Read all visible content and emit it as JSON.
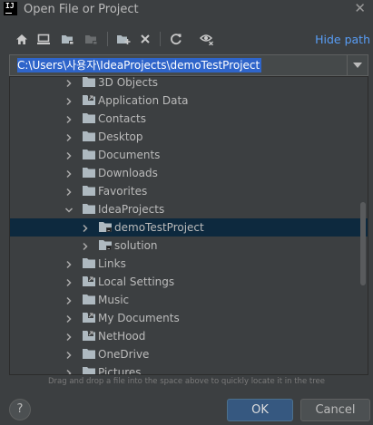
{
  "window": {
    "title": "Open File or Project",
    "app_icon_text": "IJ"
  },
  "toolbar": {
    "hide_path_label": "Hide path"
  },
  "path": {
    "value": "C:\\Users\\사용자\\IdeaProjects\\demoTestProject"
  },
  "tree": {
    "items": [
      {
        "label": "3D Objects",
        "arrow": "collapsed",
        "icon": "folder-icon",
        "level": 1
      },
      {
        "label": "Application Data",
        "arrow": "collapsed",
        "icon": "link-folder-icon",
        "level": 1
      },
      {
        "label": "Contacts",
        "arrow": "collapsed",
        "icon": "folder-icon",
        "level": 1
      },
      {
        "label": "Desktop",
        "arrow": "collapsed",
        "icon": "folder-icon",
        "level": 1
      },
      {
        "label": "Documents",
        "arrow": "collapsed",
        "icon": "folder-icon",
        "level": 1
      },
      {
        "label": "Downloads",
        "arrow": "collapsed",
        "icon": "folder-icon",
        "level": 1
      },
      {
        "label": "Favorites",
        "arrow": "collapsed",
        "icon": "folder-icon",
        "level": 1
      },
      {
        "label": "IdeaProjects",
        "arrow": "expanded",
        "icon": "folder-icon",
        "level": 1
      },
      {
        "label": "demoTestProject",
        "arrow": "collapsed",
        "icon": "project-folder-icon",
        "level": 2,
        "selected": true
      },
      {
        "label": "solution",
        "arrow": "collapsed",
        "icon": "project-folder-icon",
        "level": 2
      },
      {
        "label": "Links",
        "arrow": "collapsed",
        "icon": "folder-icon",
        "level": 1
      },
      {
        "label": "Local Settings",
        "arrow": "collapsed",
        "icon": "link-folder-icon",
        "level": 1
      },
      {
        "label": "Music",
        "arrow": "collapsed",
        "icon": "folder-icon",
        "level": 1
      },
      {
        "label": "My Documents",
        "arrow": "collapsed",
        "icon": "link-folder-icon",
        "level": 1
      },
      {
        "label": "NetHood",
        "arrow": "collapsed",
        "icon": "link-folder-icon",
        "level": 1
      },
      {
        "label": "OneDrive",
        "arrow": "collapsed",
        "icon": "folder-icon",
        "level": 1
      },
      {
        "label": "Pictures",
        "arrow": "collapsed",
        "icon": "folder-icon",
        "level": 1
      }
    ]
  },
  "hint": "Drag and drop a file into the space above to quickly locate it in the tree",
  "buttons": {
    "help": "?",
    "ok": "OK",
    "cancel": "Cancel"
  },
  "colors": {
    "selection": "#0d293e",
    "accent": "#589df6",
    "ok_button": "#365880",
    "folder": "#aeb9c0"
  }
}
